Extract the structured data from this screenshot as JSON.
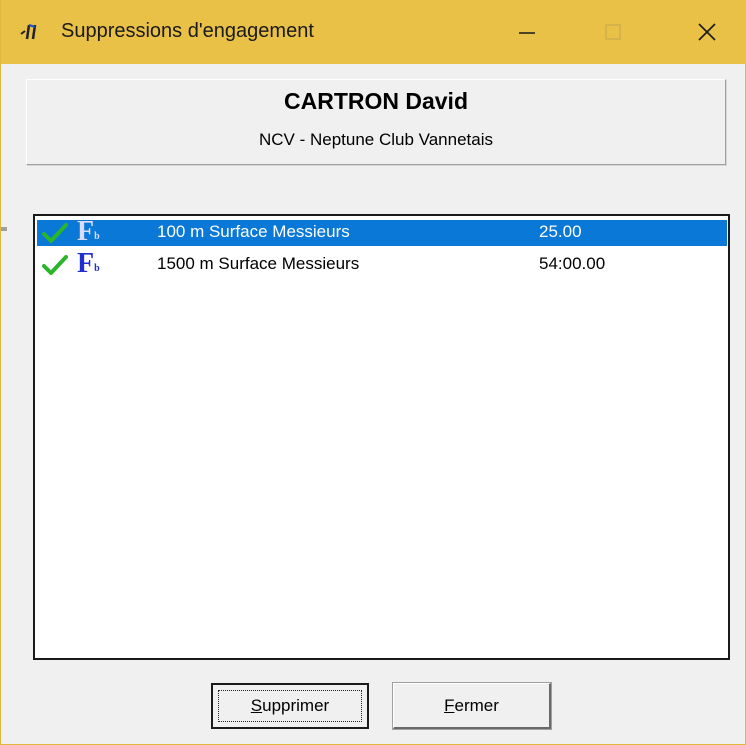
{
  "window": {
    "title": "Suppressions d'engagement",
    "icon": "flag-swimmer-icon",
    "controls": [
      "minimize-icon",
      "maximize-icon",
      "close-icon"
    ]
  },
  "swimmer": {
    "name": "CARTRON David",
    "club": "NCV - Neptune Club Vannetais"
  },
  "entries": [
    {
      "status_icon": "checkmark-icon",
      "type_icon": "fb-icon",
      "type_letter": "F",
      "type_sub": "b",
      "event": "100 m Surface Messieurs",
      "time": "25.00",
      "selected": true
    },
    {
      "status_icon": "checkmark-icon",
      "type_icon": "fb-icon",
      "type_letter": "F",
      "type_sub": "b",
      "event": "1500 m Surface Messieurs",
      "time": "54:00.00",
      "selected": false
    }
  ],
  "buttons": {
    "delete": {
      "accel": "S",
      "rest": "upprimer"
    },
    "close": {
      "accel": "F",
      "rest": "ermer"
    }
  },
  "colors": {
    "titlebar": "#e9c146",
    "selection": "#0a78d7",
    "check": "#2bb52b",
    "badge": "#1f2fd0"
  }
}
